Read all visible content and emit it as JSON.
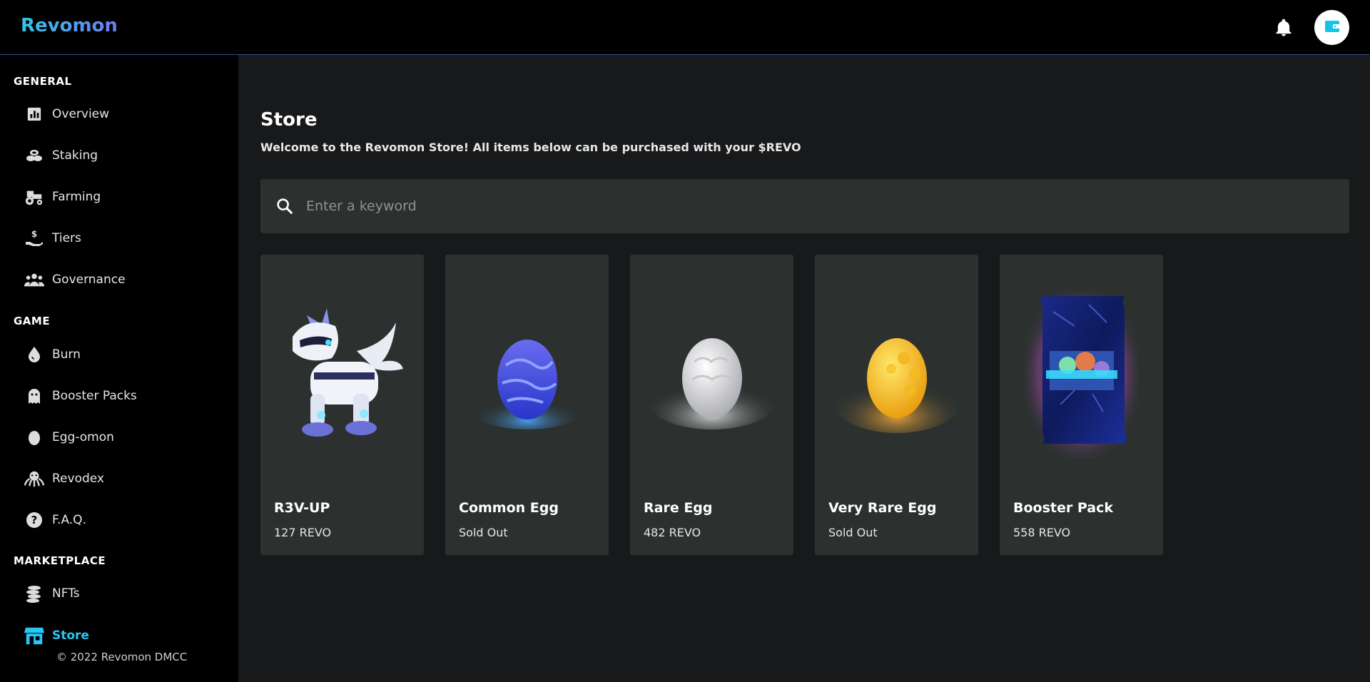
{
  "app": {
    "brand": "Revomon"
  },
  "header": {
    "bell_icon": "bell-icon",
    "wallet_icon": "wallet-icon"
  },
  "sidebar": {
    "sections": [
      {
        "title": "GENERAL"
      },
      {
        "title": "GAME"
      },
      {
        "title": "MARKETPLACE"
      }
    ],
    "items": [
      {
        "label": "Overview",
        "icon": "bar-chart-icon"
      },
      {
        "label": "Staking",
        "icon": "coins-stack-icon"
      },
      {
        "label": "Farming",
        "icon": "tractor-icon"
      },
      {
        "label": "Tiers",
        "icon": "hand-dollar-icon"
      },
      {
        "label": "Governance",
        "icon": "people-icon"
      },
      {
        "label": "Burn",
        "icon": "drop-icon"
      },
      {
        "label": "Booster Packs",
        "icon": "ghost-icon"
      },
      {
        "label": "Egg-omon",
        "icon": "egg-icon"
      },
      {
        "label": "Revodex",
        "icon": "octopus-icon"
      },
      {
        "label": "F.A.Q.",
        "icon": "question-icon"
      },
      {
        "label": "NFTs",
        "icon": "coin-pile-icon"
      },
      {
        "label": "Store",
        "icon": "store-icon",
        "active": true
      }
    ],
    "copyright": "© 2022 Revomon DMCC"
  },
  "main": {
    "title": "Store",
    "subtitle": "Welcome to the Revomon Store! All items below can be purchased with your $REVO",
    "search": {
      "placeholder": "Enter a keyword",
      "value": ""
    },
    "items": [
      {
        "name": "R3V-UP",
        "price": "127 REVO",
        "art": "robot-wolf"
      },
      {
        "name": "Common Egg",
        "price": "Sold Out",
        "art": "blue-egg"
      },
      {
        "name": "Rare Egg",
        "price": "482 REVO",
        "art": "white-egg"
      },
      {
        "name": "Very Rare Egg",
        "price": "Sold Out",
        "art": "gold-egg"
      },
      {
        "name": "Booster Pack",
        "price": "558 REVO",
        "art": "booster-pack"
      }
    ]
  },
  "colors": {
    "accent": "#29c6f0",
    "card_bg": "#2c3130",
    "page_bg": "#18191b"
  }
}
